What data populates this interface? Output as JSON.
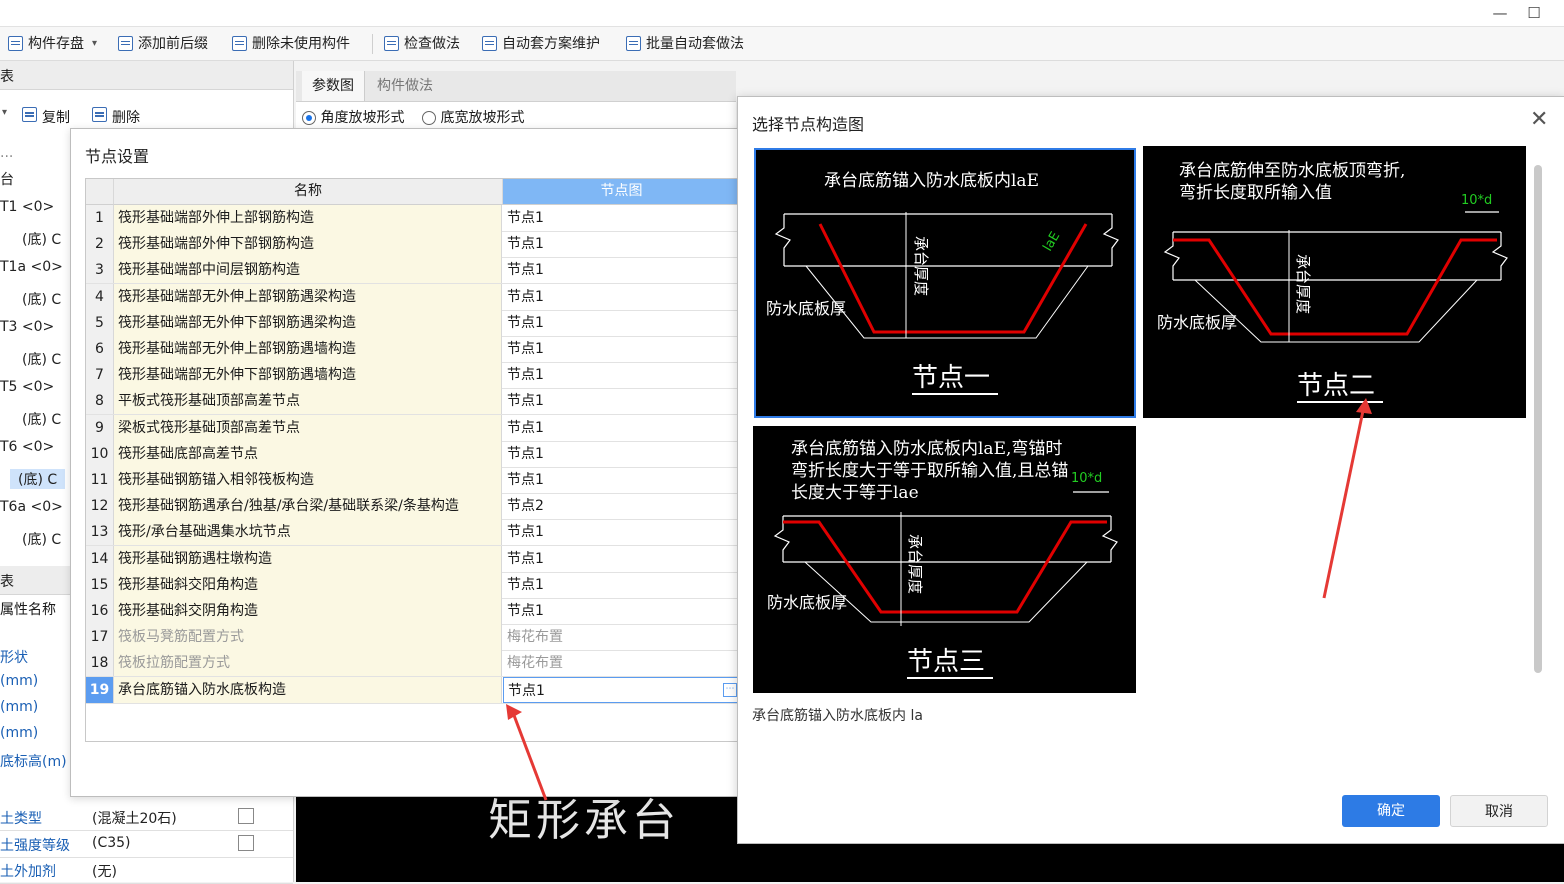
{
  "window": {
    "minimize_glyph": "—",
    "maximize_glyph": "☐"
  },
  "toolbar": {
    "items": [
      "构件存盘",
      "添加前后缀",
      "删除未使用构件",
      "检查做法",
      "自动套方案维护",
      "批量自动套做法"
    ],
    "dropdown_glyph": "▾"
  },
  "left": {
    "header_top": "表",
    "copy": "复制",
    "delete": "删除",
    "dots": "...",
    "tree": [
      "台",
      "T1 <0>",
      "(底) C",
      "T1a <0>",
      "(底) C",
      "T3 <0>",
      "(底) C",
      "T5 <0>",
      "(底) C",
      "T6 <0>",
      "(底) C",
      "T6a <0>",
      "(底) C"
    ],
    "header_bottom": "表",
    "prop_header": "属性名称",
    "props": [
      "形状",
      "(mm)",
      "(mm)",
      "(mm)",
      "底标高(m)"
    ],
    "bottom_rows": [
      {
        "name": "土类型",
        "value": "(混凝土20石)"
      },
      {
        "name": "土强度等级",
        "value": "(C35)"
      },
      {
        "name": "土外加剂",
        "value": "(无)"
      }
    ]
  },
  "mid": {
    "tabs": [
      "参数图",
      "构件做法"
    ],
    "radios": [
      "角度放坡形式",
      "底宽放坡形式"
    ],
    "canvas_text": "矩形承台"
  },
  "node_dialog": {
    "title": "节点设置",
    "headers": {
      "name": "名称",
      "image": "节点图"
    },
    "rows": [
      {
        "n": "1",
        "name": "筏形基础端部外伸上部钢筋构造",
        "val": "节点1"
      },
      {
        "n": "2",
        "name": "筏形基础端部外伸下部钢筋构造",
        "val": "节点1"
      },
      {
        "n": "3",
        "name": "筏形基础端部中间层钢筋构造",
        "val": "节点1"
      },
      {
        "n": "4",
        "name": "筏形基础端部无外伸上部钢筋遇梁构造",
        "val": "节点1"
      },
      {
        "n": "5",
        "name": "筏形基础端部无外伸下部钢筋遇梁构造",
        "val": "节点1"
      },
      {
        "n": "6",
        "name": "筏形基础端部无外伸上部钢筋遇墙构造",
        "val": "节点1"
      },
      {
        "n": "7",
        "name": "筏形基础端部无外伸下部钢筋遇墙构造",
        "val": "节点1"
      },
      {
        "n": "8",
        "name": "平板式筏形基础顶部高差节点",
        "val": "节点1"
      },
      {
        "n": "9",
        "name": "梁板式筏形基础顶部高差节点",
        "val": "节点1"
      },
      {
        "n": "10",
        "name": "筏形基础底部高差节点",
        "val": "节点1"
      },
      {
        "n": "11",
        "name": "筏形基础钢筋锚入相邻筏板构造",
        "val": "节点1"
      },
      {
        "n": "12",
        "name": "筏形基础钢筋遇承台/独基/承台梁/基础联系梁/条基构造",
        "val": "节点2"
      },
      {
        "n": "13",
        "name": "筏形/承台基础遇集水坑节点",
        "val": "节点1"
      },
      {
        "n": "14",
        "name": "筏形基础钢筋遇柱墩构造",
        "val": "节点1"
      },
      {
        "n": "15",
        "name": "筏形基础斜交阳角构造",
        "val": "节点1"
      },
      {
        "n": "16",
        "name": "筏形基础斜交阴角构造",
        "val": "节点1"
      },
      {
        "n": "17",
        "name": "筏板马凳筋配置方式",
        "val": "梅花布置"
      },
      {
        "n": "18",
        "name": "筏板拉筋配置方式",
        "val": "梅花布置"
      },
      {
        "n": "19",
        "name": "承台底筋锚入防水底板构造",
        "val": "节点1"
      }
    ],
    "edit_glyph": "⋯"
  },
  "select_dialog": {
    "title": "选择节点构造图",
    "close_glyph": "✕",
    "nodes": [
      {
        "caption": "节点一",
        "text": [
          "承台底筋锚入防水底板内laE"
        ],
        "tag": "laE",
        "side": "防水底板厚",
        "depth": "承台厚度"
      },
      {
        "caption": "节点二",
        "text": [
          "承台底筋伸至防水底板顶弯折,",
          "弯折长度取所输入值"
        ],
        "tag": "10*d",
        "side": "防水底板厚",
        "depth": "承台厚度"
      },
      {
        "caption": "节点三",
        "text": [
          "承台底筋锚入防水底板内laE,弯锚时",
          "弯折长度大于等于取所输入值,且总锚",
          "长度大于等于lae"
        ],
        "tag": "10*d",
        "side": "防水底板厚",
        "depth": "承台厚度"
      }
    ],
    "description": "承台底筋锚入防水底板内 la",
    "ok": "确定",
    "cancel": "取消"
  },
  "colors": {
    "accent": "#2d7be5",
    "rebar": "#e00000",
    "tag": "#22cc22",
    "node_bg": "#000000",
    "grid_name_bg": "#fbf8e3"
  }
}
